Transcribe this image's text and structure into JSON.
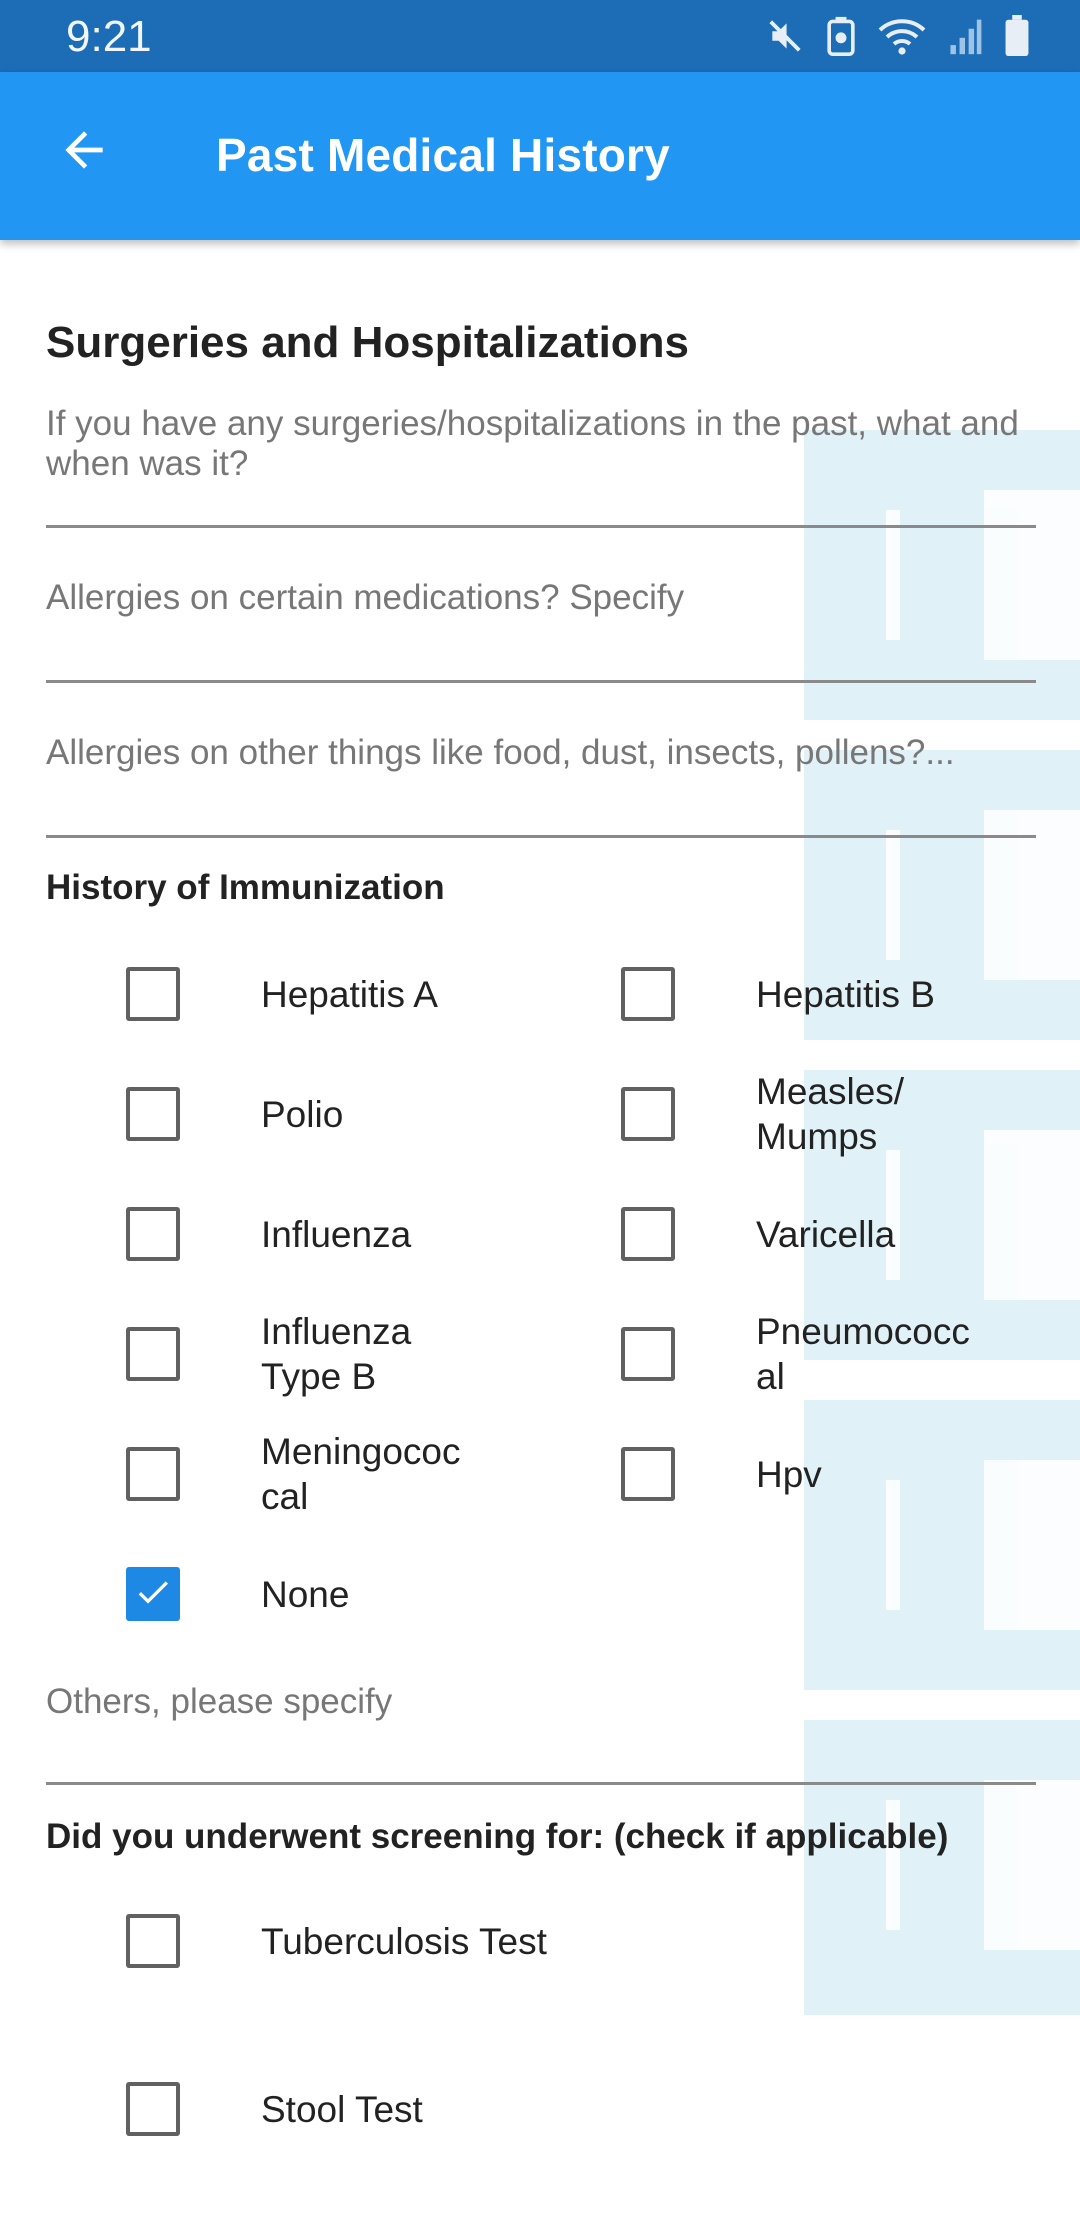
{
  "status_bar": {
    "time": "9:21",
    "icons": [
      "mute-icon",
      "battery-saver-icon",
      "wifi-icon",
      "signal-icon",
      "battery-icon"
    ]
  },
  "app_bar": {
    "title": "Past Medical History",
    "back_icon": "arrow-back-icon",
    "background": "#2196f3"
  },
  "form": {
    "section_title": "Surgeries and Hospitalizations",
    "surgeries_placeholder": "If you have any surgeries/hospitalizations in the past, what and when was it?",
    "med_allergies_placeholder": "Allergies on certain medications? Specify",
    "other_allergies_placeholder": "Allergies on other things like food, dust, insects, pollens?...",
    "immunization": {
      "heading": "History of Immunization",
      "items": [
        {
          "label": "Hepatitis A",
          "checked": false
        },
        {
          "label": "Hepatitis B",
          "checked": false
        },
        {
          "label": "Polio",
          "checked": false
        },
        {
          "label": "Measles/ Mumps",
          "checked": false
        },
        {
          "label": "Influenza",
          "checked": false
        },
        {
          "label": "Varicella",
          "checked": false
        },
        {
          "label": "Influenza Type B",
          "checked": false
        },
        {
          "label": "Pneumococc al",
          "checked": false
        },
        {
          "label": "Meningococ cal",
          "checked": false
        },
        {
          "label": "Hpv",
          "checked": false
        },
        {
          "label": "None",
          "checked": true
        }
      ]
    },
    "others_placeholder": "Others, please specify",
    "screening": {
      "heading": "Did you underwent screening for: (check if applicable)",
      "items": [
        {
          "label": "Tuberculosis Test",
          "checked": false
        },
        {
          "label": "Stool Test",
          "checked": false
        }
      ]
    }
  },
  "colors": {
    "accent": "#1e88e5",
    "status_bar": "#1c6db6",
    "watermark": "#e0f2f7"
  }
}
